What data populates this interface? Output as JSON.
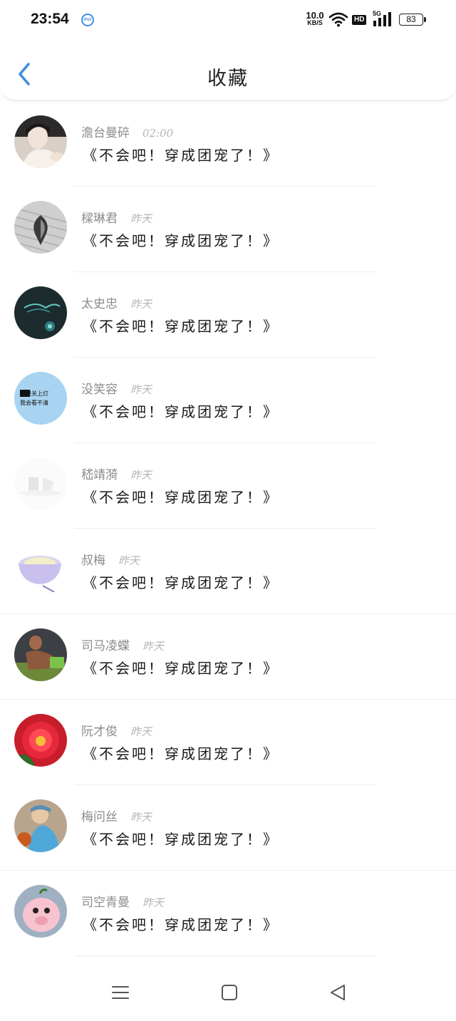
{
  "status_bar": {
    "time": "23:54",
    "app_icon": "iflytek-input-icon",
    "net_speed_value": "10.0",
    "net_speed_unit": "KB/S",
    "hd_label": "HD",
    "signal_label": "5G",
    "battery": "83"
  },
  "header": {
    "back_icon": "chevron-left-icon",
    "title": "收藏"
  },
  "accent_color": "#3f8fe0",
  "items": [
    {
      "name": "澹台曼碎",
      "time": "02:00",
      "message": "《不会吧！穿成团宠了！》",
      "avatar": "girl-photo"
    },
    {
      "name": "樑琳君",
      "time": "昨天",
      "message": "《不会吧！穿成团宠了！》",
      "avatar": "book-heart-photo"
    },
    {
      "name": "太史忠",
      "time": "昨天",
      "message": "《不会吧！穿成团宠了！》",
      "avatar": "dark-teal-art"
    },
    {
      "name": "没笑容",
      "time": "昨天",
      "message": "《不会吧！穿成团宠了！》",
      "avatar": "light-text-blue"
    },
    {
      "name": "嵇靖漪",
      "time": "昨天",
      "message": "《不会吧！穿成团宠了！》",
      "avatar": "white-sketch"
    },
    {
      "name": "叔梅",
      "time": "昨天",
      "message": "《不会吧！穿成团宠了！》",
      "avatar": "cup-drawing"
    },
    {
      "name": "司马凌蝶",
      "time": "昨天",
      "message": "《不会吧！穿成团宠了！》",
      "avatar": "fitness-photo"
    },
    {
      "name": "阮才俊",
      "time": "昨天",
      "message": "《不会吧！穿成团宠了！》",
      "avatar": "red-flower"
    },
    {
      "name": "梅问丝",
      "time": "昨天",
      "message": "《不会吧！穿成团宠了！》",
      "avatar": "basketball-player"
    },
    {
      "name": "司空青曼",
      "time": "昨天",
      "message": "《不会吧！穿成团宠了！》",
      "avatar": "cartoon-pig"
    }
  ],
  "avatar_texts": {
    "line1": "如果关上灯",
    "line2": "我会看不清"
  },
  "nav_bar": {
    "menu_icon": "menu-icon",
    "home_icon": "home-square-icon",
    "back_icon": "back-triangle-icon"
  }
}
